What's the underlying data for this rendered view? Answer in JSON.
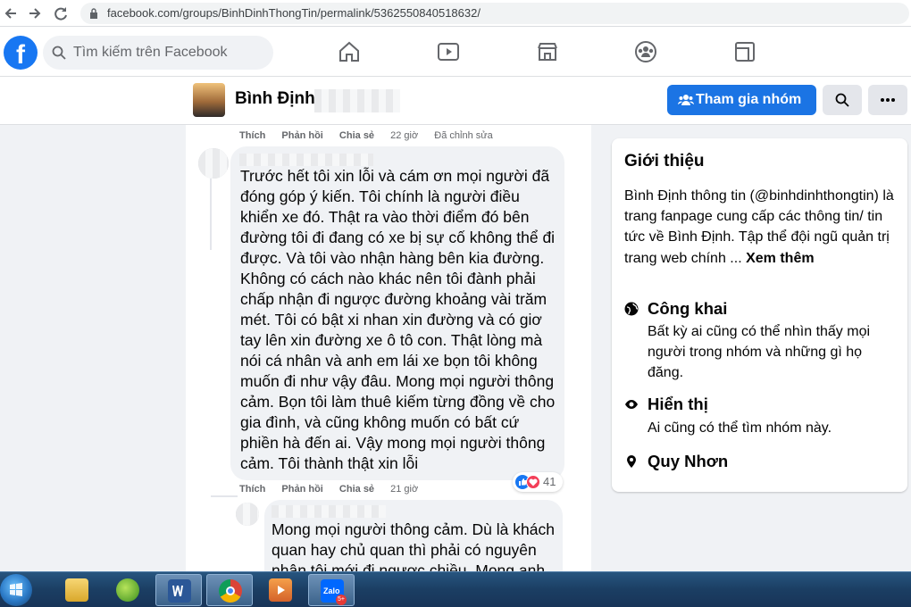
{
  "browser": {
    "url": "facebook.com/groups/BinhDinhThongTin/permalink/5362550840518632/",
    "back_icon": "back-arrow-icon",
    "forward_icon": "forward-arrow-icon",
    "reload_icon": "reload-icon"
  },
  "fb_header": {
    "logo": "f",
    "search_placeholder": "Tìm kiếm trên Facebook",
    "nav_icons": [
      "home-icon",
      "watch-icon",
      "marketplace-icon",
      "groups-icon",
      "gaming-icon"
    ]
  },
  "group": {
    "name": "Bình Định",
    "join_label": "Tham gia nhóm",
    "search_icon": "search-icon",
    "more_icon": "more-icon"
  },
  "feed": {
    "prev_actions": {
      "like": "Thích",
      "reply": "Phản hồi",
      "share": "Chia sẻ",
      "time": "22 giờ",
      "edited": "Đã chỉnh sửa"
    },
    "main_comment": {
      "lines": [
        "Trước hết tôi xin lỗi và cám ơn mọi người đã",
        "đóng góp ý kiến. Tôi chính là người điều",
        "khiển xe đó. Thật ra vào thời điểm đó bên",
        "đường tôi đi đang có xe bị sự cố không thể đi",
        "được. Và tôi vào nhận hàng bên kia đường.",
        "Không có cách nào khác nên tôi đành phải",
        "chấp nhận đi ngược đường khoảng vài trăm",
        "mét. Tôi có bật xi nhan xin đường và có giơ",
        "tay lên xin đường xe ô tô con. Thật lòng mà",
        "nói cá nhân và anh em lái xe bọn tôi không",
        "muốn đi như vậy đâu. Mong mọi người thông",
        "cảm. Bọn tôi làm thuê kiếm từng đồng về cho",
        "gia đình, và cũng không muốn có bất cứ",
        "phiền hà đến ai. Vậy mong mọi người thông",
        "cảm. Tôi thành thật xin lỗi"
      ],
      "reaction_count": "41",
      "actions": {
        "like": "Thích",
        "reply": "Phản hồi",
        "share": "Chia sẻ",
        "time": "21 giờ"
      }
    },
    "reply_comment": {
      "lines": [
        "Mong mọi người thông cảm. Dù là khách",
        "quan hay chủ quan thì phải có nguyên",
        "nhân tôi mới đi ngược chiều. Mong anh"
      ]
    }
  },
  "intro": {
    "title": "Giới thiệu",
    "description": "Bình Định thông tin (@binhdinhthongtin) là trang fanpage cung cấp các thông tin/ tin tức về Bình Định. Tập thể đội ngũ quản trị trang web chính ...",
    "see_more": "Xem thêm",
    "public_title": "Công khai",
    "public_desc": "Bất kỳ ai cũng có thể nhìn thấy mọi người trong nhóm và những gì họ đăng.",
    "visible_title": "Hiển thị",
    "visible_desc": "Ai cũng có thể tìm nhóm này.",
    "location": "Quy Nhơn"
  },
  "taskbar": {
    "apps": [
      "file-explorer-icon",
      "coccoc-icon",
      "word-icon",
      "chrome-icon",
      "media-player-icon",
      "zalo-icon"
    ],
    "zalo_label": "Zalo",
    "zalo_badge": "5+"
  },
  "colors": {
    "fb_blue": "#1877f2",
    "join_blue": "#1b74e4",
    "page_bg": "#f0f2f5",
    "bubble_bg": "#f0f2f5"
  }
}
